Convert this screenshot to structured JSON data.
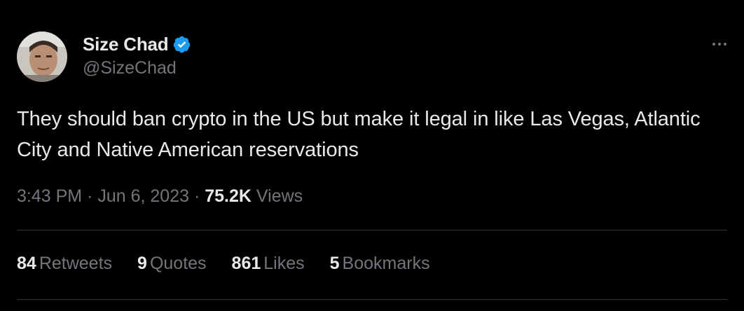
{
  "author": {
    "display_name": "Size Chad",
    "handle": "@SizeChad",
    "verified_icon": "verified-badge-icon",
    "avatar_icon": "avatar",
    "verified_color": "#1d9bf0"
  },
  "more_icon": "more-horizontal-icon",
  "tweet": {
    "text": "They should ban crypto in the US but make it legal in like Las Vegas, Atlantic City and Native American reservations"
  },
  "meta": {
    "time": "3:43 PM",
    "separator": "·",
    "date": "Jun 6, 2023",
    "views_count": "75.2K",
    "views_label": "Views"
  },
  "stats": [
    {
      "count": "84",
      "label": "Retweets"
    },
    {
      "count": "9",
      "label": "Quotes"
    },
    {
      "count": "861",
      "label": "Likes"
    },
    {
      "count": "5",
      "label": "Bookmarks"
    }
  ],
  "colors": {
    "background": "#000000",
    "primary_text": "#e7e9ea",
    "secondary_text": "#71767b",
    "divider": "#2f3336"
  }
}
